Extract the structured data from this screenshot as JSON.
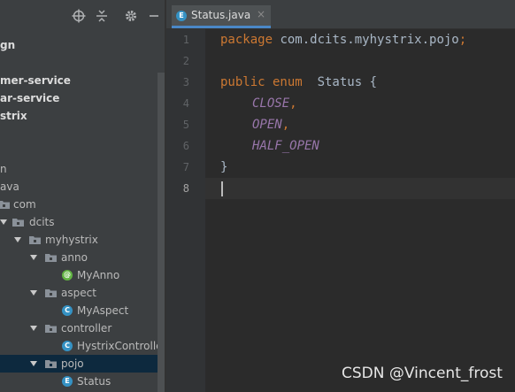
{
  "toolbar": {
    "icons": [
      "locate-icon",
      "collapse-all-icon",
      "gear-icon",
      "hide-icon"
    ]
  },
  "tree": [
    {
      "label": "gn",
      "kind": "text",
      "bold": true
    },
    {
      "label": "mer-service",
      "kind": "text",
      "bold": true
    },
    {
      "label": "ar-service",
      "kind": "text",
      "bold": true
    },
    {
      "label": "strix",
      "kind": "text",
      "bold": true
    },
    {
      "label": "n",
      "kind": "text"
    },
    {
      "label": "ava",
      "kind": "text"
    },
    {
      "label": "com",
      "kind": "package"
    },
    {
      "label": "dcits",
      "kind": "package"
    },
    {
      "label": "myhystrix",
      "kind": "package"
    },
    {
      "label": "anno",
      "kind": "package"
    },
    {
      "label": "MyAnno",
      "kind": "annotation"
    },
    {
      "label": "aspect",
      "kind": "package"
    },
    {
      "label": "MyAspect",
      "kind": "class"
    },
    {
      "label": "controller",
      "kind": "package"
    },
    {
      "label": "HystrixController",
      "kind": "class"
    },
    {
      "label": "pojo",
      "kind": "package",
      "selected": true
    },
    {
      "label": "Status",
      "kind": "enum"
    }
  ],
  "editor": {
    "tab_label": "Status.java",
    "tab_close": "×",
    "line_numbers": [
      "1",
      "2",
      "3",
      "4",
      "5",
      "6",
      "7",
      "8"
    ],
    "lines": {
      "l1_kw": "package",
      "l1_rest": " com.dcits.myhystrix.pojo",
      "l1_semi": ";",
      "l3_kw": "public enum",
      "l3_name": "  Status ",
      "l3_brace": "{",
      "l4_const": "CLOSE",
      "l4_comma": ",",
      "l5_const": "OPEN",
      "l5_comma": ",",
      "l6_const": "HALF_OPEN",
      "l7_brace": "}"
    },
    "current_line": "8"
  },
  "badges": {
    "class": "C",
    "annotation": "@",
    "enum": "E"
  },
  "watermark": "CSDN @Vincent_frost",
  "colors": {
    "panel_bg": "#3c3f41",
    "editor_bg": "#2b2b2b",
    "keyword": "#cc7832",
    "constant": "#9876aa",
    "selection": "#0d293e"
  }
}
